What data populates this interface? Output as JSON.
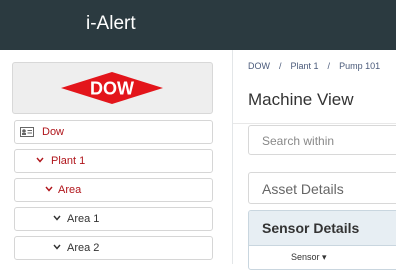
{
  "header": {
    "title": "i-Alert"
  },
  "sidebar": {
    "logo": {
      "text": "DOW",
      "color": "#e3151b"
    },
    "tree": [
      {
        "label": "Dow",
        "icon": "id-card-icon"
      },
      {
        "label": "Plant 1",
        "icon": "chevron-down-icon"
      },
      {
        "label": "Area",
        "icon": "chevron-down-icon"
      },
      {
        "label": "Area 1",
        "icon": "chevron-down-icon"
      },
      {
        "label": "Area 2",
        "icon": "chevron-down-icon"
      }
    ]
  },
  "main": {
    "breadcrumb": [
      "DOW",
      "Plant 1",
      "Pump 101"
    ],
    "breadcrumb_sep": "/",
    "title": "Machine View",
    "search_placeholder": "Search within",
    "asset_details_label": "Asset Details",
    "sensor_details_label": "Sensor Details",
    "sensor_column": "Sensor ▾"
  },
  "colors": {
    "topbar": "#2b3a40",
    "accent_red": "#b0151b"
  }
}
